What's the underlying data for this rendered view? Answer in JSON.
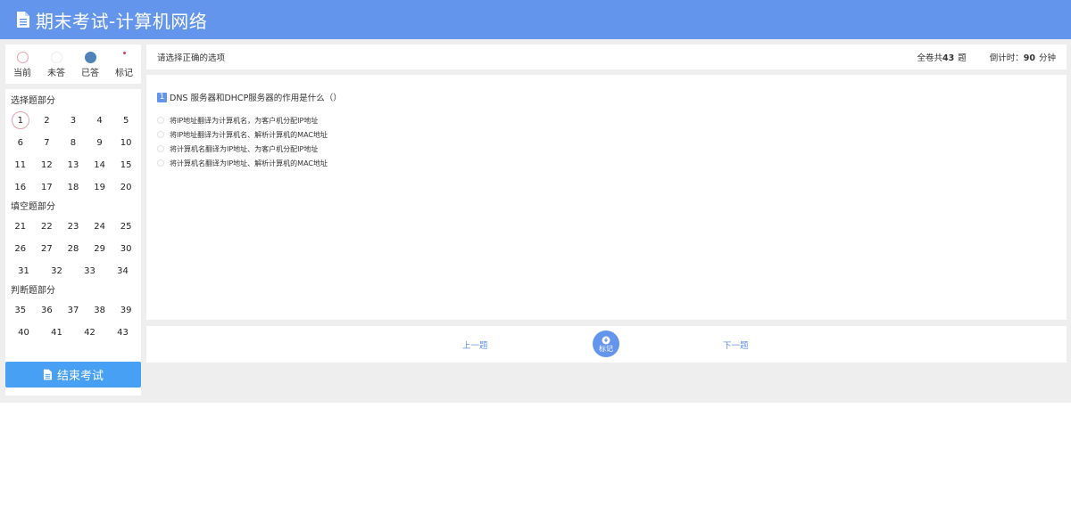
{
  "header": {
    "title": "期末考试-计算机网络"
  },
  "legend": [
    {
      "label": "当前",
      "state": "current"
    },
    {
      "label": "未答",
      "state": "unanswered"
    },
    {
      "label": "已答",
      "state": "answered"
    },
    {
      "label": "标记",
      "state": "flagged"
    }
  ],
  "sections": [
    {
      "title": "选择题部分",
      "rows": [
        [
          "1",
          "2",
          "3",
          "4",
          "5"
        ],
        [
          "6",
          "7",
          "8",
          "9",
          "10"
        ],
        [
          "11",
          "12",
          "13",
          "14",
          "15"
        ],
        [
          "16",
          "17",
          "18",
          "19",
          "20"
        ]
      ]
    },
    {
      "title": "填空题部分",
      "rows": [
        [
          "21",
          "22",
          "23",
          "24",
          "25"
        ],
        [
          "26",
          "27",
          "28",
          "29",
          "30"
        ],
        [
          "31",
          "32",
          "33",
          "34"
        ]
      ]
    },
    {
      "title": "判断题部分",
      "rows": [
        [
          "35",
          "36",
          "37",
          "38",
          "39"
        ],
        [
          "40",
          "41",
          "42",
          "43"
        ]
      ]
    }
  ],
  "current_question": "1",
  "end_button": {
    "label": "结束考试"
  },
  "topbar": {
    "instruction": "请选择正确的选项",
    "total_prefix": "全卷共",
    "total_count": "43",
    "total_suffix": "题",
    "timer_label": "倒计时：",
    "timer_value": "90",
    "timer_unit": "分钟"
  },
  "question": {
    "number": "1",
    "text": "DNS 服务器和DHCP服务器的作用是什么（）",
    "options": [
      "将IP地址翻译为计算机名，为客户机分配IP地址",
      "将IP地址翻译为计算机名、解析计算机的MAC地址",
      "将计算机名翻译为IP地址、为客户机分配IP地址",
      "将计算机名翻译为IP地址、解析计算机的MAC地址"
    ]
  },
  "nav": {
    "prev": "上一题",
    "flag": "标记",
    "next": "下一题"
  },
  "colors": {
    "header": "#6495ED",
    "answered": "#4f82b8",
    "end_button": "#48a0f5",
    "current_ring": "#e6a3b0"
  }
}
